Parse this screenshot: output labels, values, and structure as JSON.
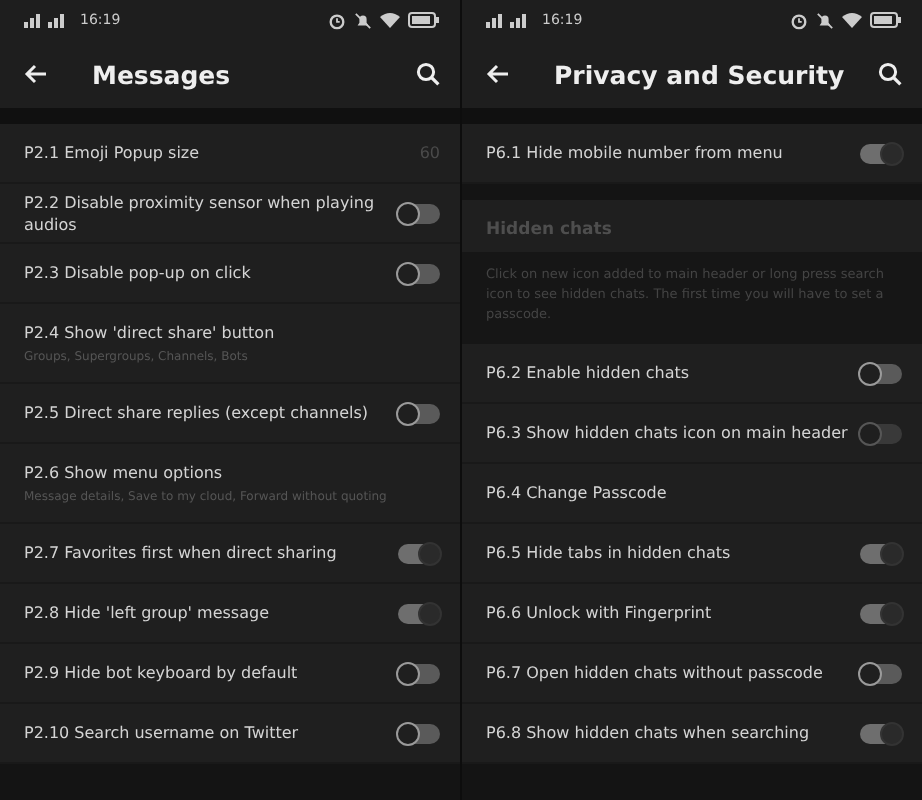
{
  "screens": [
    {
      "status_bar": {
        "time": "16:19"
      },
      "title": "Messages",
      "sections": [
        {
          "kind": "list",
          "rows": [
            {
              "kind": "value",
              "label": "P2.1 Emoji Popup size",
              "value": "60"
            },
            {
              "kind": "toggle",
              "label": "P2.2 Disable proximity sensor when playing audios",
              "on": false,
              "disabled": false
            },
            {
              "kind": "toggle",
              "label": "P2.3 Disable pop-up on click",
              "on": false,
              "disabled": false
            },
            {
              "kind": "plain",
              "label": "P2.4 Show 'direct share' button",
              "subtitle": "Groups, Supergroups, Channels, Bots"
            },
            {
              "kind": "toggle",
              "label": "P2.5 Direct share replies (except channels)",
              "on": false,
              "disabled": false
            },
            {
              "kind": "plain",
              "label": "P2.6 Show menu options",
              "subtitle": "Message details, Save to my cloud, Forward without quoting"
            },
            {
              "kind": "toggle",
              "label": "P2.7 Favorites first when direct sharing",
              "on": true,
              "disabled": false
            },
            {
              "kind": "toggle",
              "label": "P2.8 Hide 'left group' message",
              "on": true,
              "disabled": false
            },
            {
              "kind": "toggle",
              "label": "P2.9 Hide bot keyboard by default",
              "on": false,
              "disabled": false
            },
            {
              "kind": "toggle",
              "label": "P2.10 Search username on Twitter",
              "on": false,
              "disabled": false
            }
          ]
        }
      ]
    },
    {
      "status_bar": {
        "time": "16:19"
      },
      "title": "Privacy and Security",
      "sections": [
        {
          "kind": "list",
          "rows": [
            {
              "kind": "toggle",
              "label": "P6.1 Hide mobile number from menu",
              "on": true,
              "disabled": false
            }
          ]
        },
        {
          "kind": "header",
          "title": "Hidden chats",
          "description": "Click on new icon added to main header or long press search icon to see hidden chats. The first time you will have to set a passcode."
        },
        {
          "kind": "list",
          "rows": [
            {
              "kind": "toggle",
              "label": "P6.2 Enable hidden chats",
              "on": false,
              "disabled": false
            },
            {
              "kind": "toggle",
              "label": "P6.3 Show hidden chats icon on main header",
              "on": false,
              "disabled": true
            },
            {
              "kind": "plain",
              "label": "P6.4 Change Passcode"
            },
            {
              "kind": "toggle",
              "label": "P6.5 Hide tabs in hidden chats",
              "on": true,
              "disabled": false
            },
            {
              "kind": "toggle",
              "label": "P6.6 Unlock with Fingerprint",
              "on": true,
              "disabled": false
            },
            {
              "kind": "toggle",
              "label": "P6.7 Open hidden chats without passcode",
              "on": false,
              "disabled": false
            },
            {
              "kind": "toggle",
              "label": "P6.8 Show hidden chats when searching",
              "on": true,
              "disabled": false
            }
          ]
        }
      ]
    }
  ]
}
